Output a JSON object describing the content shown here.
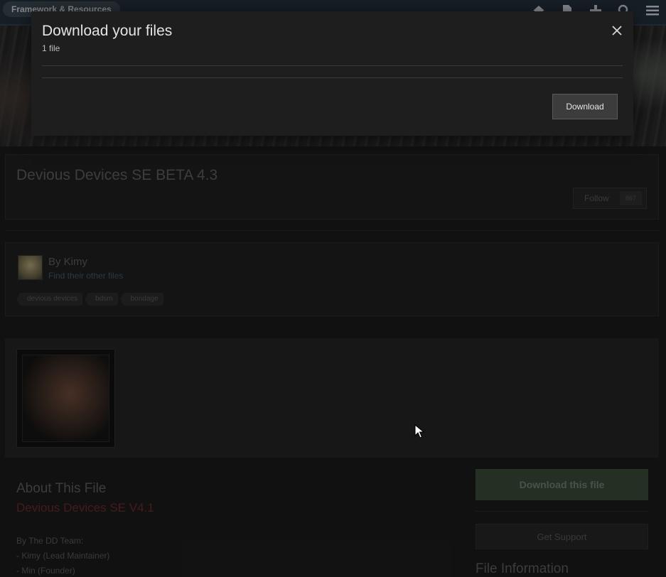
{
  "nav": {
    "breadcrumb": "Framework & Resources",
    "icons": [
      "home-icon",
      "document-icon",
      "add-icon",
      "search-icon",
      "menu-icon"
    ]
  },
  "file": {
    "title": "Devious Devices SE BETA 4.3",
    "follow_label": "Follow",
    "follow_count": "867"
  },
  "author": {
    "by_line": "By Kimy",
    "other_files": "Find their other files",
    "tags": [
      "devious devices",
      "bdsm",
      "bondage"
    ]
  },
  "about": {
    "title": "About This File",
    "subtitle": "Devious Devices SE V4.1",
    "lines": [
      "By The DD Team:",
      "- Kimy (Lead Maintainer)",
      "- Min (Founder)"
    ]
  },
  "sidebar": {
    "download_this_file": "Download this file",
    "get_support": "Get Support",
    "file_information": "File Information"
  },
  "modal": {
    "title": "Download your files",
    "count": "1 file",
    "download_label": "Download"
  },
  "colors": {
    "accent_green": "#3a4a3a",
    "accent_red": "#6b2a2a",
    "link_blue": "#3e5a66"
  }
}
